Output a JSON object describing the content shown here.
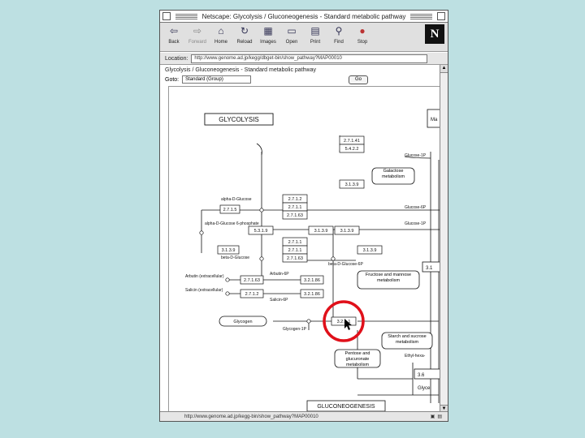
{
  "window": {
    "title": "Netscape: Glycolysis / Gluconeogenesis - Standard metabolic pathway"
  },
  "toolbar": {
    "buttons": [
      {
        "label": "Back",
        "icon": "back-arrow-icon",
        "enabled": true
      },
      {
        "label": "Forward",
        "icon": "forward-arrow-icon",
        "enabled": false
      },
      {
        "label": "Home",
        "icon": "home-icon",
        "enabled": true
      },
      {
        "label": "Reload",
        "icon": "reload-icon",
        "enabled": true
      },
      {
        "label": "Images",
        "icon": "images-icon",
        "enabled": true
      },
      {
        "label": "Open",
        "icon": "open-icon",
        "enabled": true
      },
      {
        "label": "Print",
        "icon": "print-icon",
        "enabled": true
      },
      {
        "label": "Find",
        "icon": "find-icon",
        "enabled": true
      },
      {
        "label": "Stop",
        "icon": "stop-icon",
        "enabled": true
      }
    ],
    "logo": "N"
  },
  "location": {
    "label": "Location:",
    "url": "http://www.genome.ad.jp/kegg/dbget-bin/show_pathway?MAP00010"
  },
  "page": {
    "title": "Glycolysis / Gluconeogenesis - Standard metabolic pathway",
    "go_label": "Goto:",
    "go_value": "Standard (Group)",
    "go_button": "Go"
  },
  "status": {
    "url": "http://www.genome.ad.jp/kegg-bin/show_pathway?MAP00010"
  },
  "pathway": {
    "glycolysis_label": "GLYCOLYSIS",
    "gluconeogenesis_label": "GLUCONEOGENESIS",
    "ec": {
      "e1": "2.7.1.41",
      "e2": "5.4.2.2",
      "e3": "3.1.3.9",
      "e4": "2.7.1.2",
      "e5": "2.7.1.1",
      "e6": "2.7.1.63",
      "e7": "2.7.1.5",
      "e8": "5.3.1.9",
      "e9": "3.1.3.9",
      "e10": "3.1.3.9",
      "e11": "2.7.1.1",
      "e12": "2.7.1.1",
      "e13": "2.7.1.63",
      "e14": "3.2.1.86",
      "e15": "2.7.1.63",
      "e16": "3.2.1.86",
      "e17": "3.2.1.1",
      "e18": "5.1.3.3",
      "e19": "3.1.3.9",
      "e20": "2.7.1.2",
      "e21": "5.3.1.9",
      "e22": "3.1.3.9"
    },
    "compounds": {
      "agluc": "alpha-D-Glucose",
      "agluc6p": "alpha-D-Glucose 6-phosphate",
      "bgluc": "beta-D-Glucose",
      "bgluc6p": "beta-D-Glucose-6P",
      "arbutin": "Arbutin (extracellular)",
      "salicin": "Salicin (extracellular)",
      "arbutin6p": "Arbutin-6P",
      "salicin6p": "Salicin-6P",
      "glycogen_l": "Glycogen",
      "glucose1p": "Glycogen-1P",
      "glucose1p_r": "Glucose-1P",
      "glucose6p_r": "Glucose-6P",
      "g1p_top": "Glucose-1P"
    },
    "maps": {
      "galactose": "Galactose metabolism",
      "fructose": "Fructose and mannose metabolism",
      "starch": "Starch and sucrose metabolism",
      "pentose": "Pentose and glucuronate metabolism",
      "ethylhex": "Ethyl-hexa-"
    },
    "right_cut": {
      "r1": "Ma",
      "r2": "3.1",
      "r3": "3.6",
      "r4": "Glyce"
    }
  }
}
